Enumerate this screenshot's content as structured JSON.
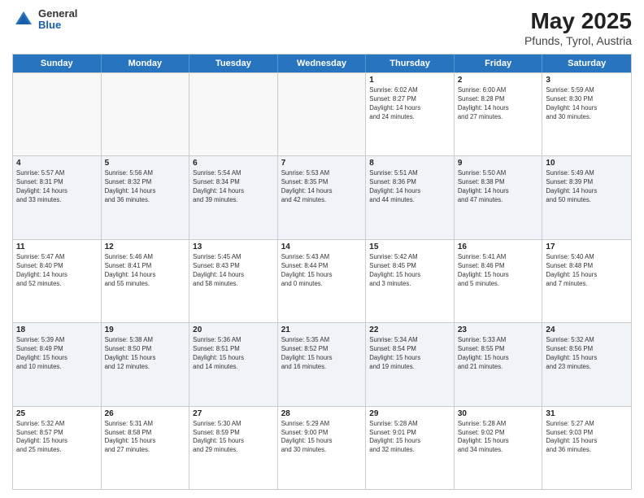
{
  "logo": {
    "general": "General",
    "blue": "Blue"
  },
  "title": {
    "month": "May 2025",
    "location": "Pfunds, Tyrol, Austria"
  },
  "weekdays": [
    "Sunday",
    "Monday",
    "Tuesday",
    "Wednesday",
    "Thursday",
    "Friday",
    "Saturday"
  ],
  "rows": [
    [
      {
        "day": "",
        "info": ""
      },
      {
        "day": "",
        "info": ""
      },
      {
        "day": "",
        "info": ""
      },
      {
        "day": "",
        "info": ""
      },
      {
        "day": "1",
        "info": "Sunrise: 6:02 AM\nSunset: 8:27 PM\nDaylight: 14 hours\nand 24 minutes."
      },
      {
        "day": "2",
        "info": "Sunrise: 6:00 AM\nSunset: 8:28 PM\nDaylight: 14 hours\nand 27 minutes."
      },
      {
        "day": "3",
        "info": "Sunrise: 5:59 AM\nSunset: 8:30 PM\nDaylight: 14 hours\nand 30 minutes."
      }
    ],
    [
      {
        "day": "4",
        "info": "Sunrise: 5:57 AM\nSunset: 8:31 PM\nDaylight: 14 hours\nand 33 minutes."
      },
      {
        "day": "5",
        "info": "Sunrise: 5:56 AM\nSunset: 8:32 PM\nDaylight: 14 hours\nand 36 minutes."
      },
      {
        "day": "6",
        "info": "Sunrise: 5:54 AM\nSunset: 8:34 PM\nDaylight: 14 hours\nand 39 minutes."
      },
      {
        "day": "7",
        "info": "Sunrise: 5:53 AM\nSunset: 8:35 PM\nDaylight: 14 hours\nand 42 minutes."
      },
      {
        "day": "8",
        "info": "Sunrise: 5:51 AM\nSunset: 8:36 PM\nDaylight: 14 hours\nand 44 minutes."
      },
      {
        "day": "9",
        "info": "Sunrise: 5:50 AM\nSunset: 8:38 PM\nDaylight: 14 hours\nand 47 minutes."
      },
      {
        "day": "10",
        "info": "Sunrise: 5:49 AM\nSunset: 8:39 PM\nDaylight: 14 hours\nand 50 minutes."
      }
    ],
    [
      {
        "day": "11",
        "info": "Sunrise: 5:47 AM\nSunset: 8:40 PM\nDaylight: 14 hours\nand 52 minutes."
      },
      {
        "day": "12",
        "info": "Sunrise: 5:46 AM\nSunset: 8:41 PM\nDaylight: 14 hours\nand 55 minutes."
      },
      {
        "day": "13",
        "info": "Sunrise: 5:45 AM\nSunset: 8:43 PM\nDaylight: 14 hours\nand 58 minutes."
      },
      {
        "day": "14",
        "info": "Sunrise: 5:43 AM\nSunset: 8:44 PM\nDaylight: 15 hours\nand 0 minutes."
      },
      {
        "day": "15",
        "info": "Sunrise: 5:42 AM\nSunset: 8:45 PM\nDaylight: 15 hours\nand 3 minutes."
      },
      {
        "day": "16",
        "info": "Sunrise: 5:41 AM\nSunset: 8:46 PM\nDaylight: 15 hours\nand 5 minutes."
      },
      {
        "day": "17",
        "info": "Sunrise: 5:40 AM\nSunset: 8:48 PM\nDaylight: 15 hours\nand 7 minutes."
      }
    ],
    [
      {
        "day": "18",
        "info": "Sunrise: 5:39 AM\nSunset: 8:49 PM\nDaylight: 15 hours\nand 10 minutes."
      },
      {
        "day": "19",
        "info": "Sunrise: 5:38 AM\nSunset: 8:50 PM\nDaylight: 15 hours\nand 12 minutes."
      },
      {
        "day": "20",
        "info": "Sunrise: 5:36 AM\nSunset: 8:51 PM\nDaylight: 15 hours\nand 14 minutes."
      },
      {
        "day": "21",
        "info": "Sunrise: 5:35 AM\nSunset: 8:52 PM\nDaylight: 15 hours\nand 16 minutes."
      },
      {
        "day": "22",
        "info": "Sunrise: 5:34 AM\nSunset: 8:54 PM\nDaylight: 15 hours\nand 19 minutes."
      },
      {
        "day": "23",
        "info": "Sunrise: 5:33 AM\nSunset: 8:55 PM\nDaylight: 15 hours\nand 21 minutes."
      },
      {
        "day": "24",
        "info": "Sunrise: 5:32 AM\nSunset: 8:56 PM\nDaylight: 15 hours\nand 23 minutes."
      }
    ],
    [
      {
        "day": "25",
        "info": "Sunrise: 5:32 AM\nSunset: 8:57 PM\nDaylight: 15 hours\nand 25 minutes."
      },
      {
        "day": "26",
        "info": "Sunrise: 5:31 AM\nSunset: 8:58 PM\nDaylight: 15 hours\nand 27 minutes."
      },
      {
        "day": "27",
        "info": "Sunrise: 5:30 AM\nSunset: 8:59 PM\nDaylight: 15 hours\nand 29 minutes."
      },
      {
        "day": "28",
        "info": "Sunrise: 5:29 AM\nSunset: 9:00 PM\nDaylight: 15 hours\nand 30 minutes."
      },
      {
        "day": "29",
        "info": "Sunrise: 5:28 AM\nSunset: 9:01 PM\nDaylight: 15 hours\nand 32 minutes."
      },
      {
        "day": "30",
        "info": "Sunrise: 5:28 AM\nSunset: 9:02 PM\nDaylight: 15 hours\nand 34 minutes."
      },
      {
        "day": "31",
        "info": "Sunrise: 5:27 AM\nSunset: 9:03 PM\nDaylight: 15 hours\nand 36 minutes."
      }
    ]
  ],
  "emptyFirstRow": [
    true,
    true,
    true,
    true,
    false,
    false,
    false
  ],
  "altRows": [
    false,
    true,
    false,
    true,
    false
  ]
}
